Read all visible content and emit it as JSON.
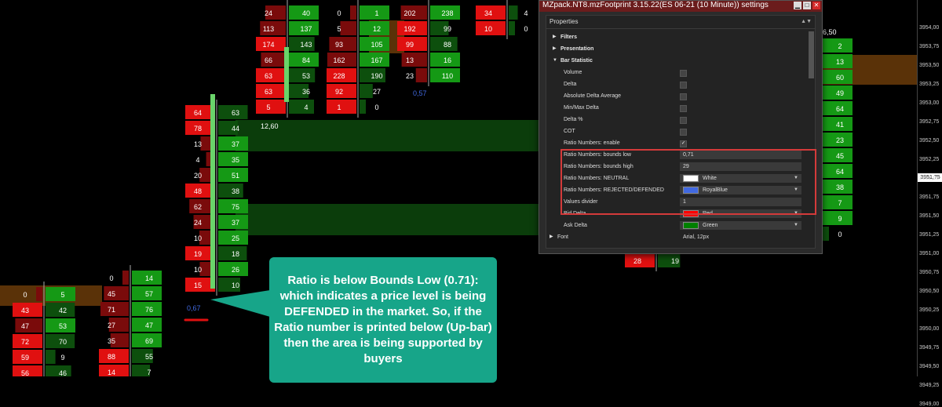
{
  "dialog": {
    "title": "MZpack.NT8.mzFootprint 3.15.22(ES 06-21 (10 Minute)) settings",
    "controls": {
      "minimize": "▁",
      "maximize": "□",
      "close": "✕"
    },
    "properties_header": "Properties",
    "categories": [
      {
        "label": "Filters",
        "expanded": false
      },
      {
        "label": "Presentation",
        "expanded": false
      },
      {
        "label": "Bar Statistic",
        "expanded": true
      }
    ],
    "items": [
      {
        "label": "Volume",
        "type": "checkbox",
        "checked": false
      },
      {
        "label": "Delta",
        "type": "checkbox",
        "checked": false
      },
      {
        "label": "Absolute Delta Average",
        "type": "checkbox",
        "checked": false
      },
      {
        "label": "Min/Max Delta",
        "type": "checkbox",
        "checked": false
      },
      {
        "label": "Delta %",
        "type": "checkbox",
        "checked": false
      },
      {
        "label": "COT",
        "type": "checkbox",
        "checked": false
      },
      {
        "label": "Ratio Numbers: enable",
        "type": "checkbox",
        "checked": true,
        "mark": "✓"
      },
      {
        "label": "Ratio Numbers: bounds low",
        "type": "text",
        "value": "0,71"
      },
      {
        "label": "Ratio Numbers: bounds high",
        "type": "text",
        "value": "29"
      },
      {
        "label": "Ratio Numbers: NEUTRAL",
        "type": "color",
        "value": "White",
        "color": "#ffffff"
      },
      {
        "label": "Ratio Numbers: REJECTED/DEFENDED",
        "type": "color",
        "value": "RoyalBlue",
        "color": "#4169e1"
      },
      {
        "label": "Values divider",
        "type": "text",
        "value": "1"
      },
      {
        "label": "Bid Delta",
        "type": "color",
        "value": "Red",
        "color": "#ff0000"
      },
      {
        "label": "Ask Delta",
        "type": "color",
        "value": "Green",
        "color": "#008000"
      }
    ],
    "font": {
      "label": "Font",
      "value": "Arial, 12px"
    }
  },
  "price_axis": {
    "ticks": [
      "3954,00",
      "3953,75",
      "3953,50",
      "3953,25",
      "3953,00",
      "3952,75",
      "3952,50",
      "3952,25",
      "3952,00",
      "3951,75",
      "3951,50",
      "3951,25",
      "3951,00",
      "3950,75",
      "3950,50",
      "3950,25",
      "3950,00",
      "3949,75",
      "3949,50",
      "3949,25",
      "3949,00"
    ],
    "current": "3951,75"
  },
  "colors": {
    "bid_strong": "#e01010",
    "bid_dark": "#7a0b0b",
    "ask_strong": "#159915",
    "ask_dark": "#0d4f0d",
    "zone_green": "#0b3d0b",
    "zone_orange": "#5a3208",
    "ratio_blue": "#4169e1"
  },
  "chart_labels": {
    "ratio_right": "6,50",
    "ratio_mid": "12,60",
    "ratio_top": "0,57",
    "ratio_left": "0,67"
  },
  "callout": {
    "text": "Ratio is below Bounds Low (0.71): which indicates a price level is being DEFENDED in the market. So, if the Ratio number is printed below (Up-bar) then the area is being supported by buyers"
  },
  "footprint": {
    "columns": [
      {
        "name": "left",
        "rows": [
          [
            "0",
            "5"
          ],
          [
            "43",
            "42"
          ],
          [
            "47",
            "53"
          ],
          [
            "72",
            "70"
          ],
          [
            "59",
            "9"
          ],
          [
            "56",
            "46"
          ]
        ]
      },
      {
        "name": "left2",
        "rows": [
          [
            "0",
            "14"
          ],
          [
            "45",
            "57"
          ],
          [
            "71",
            "76"
          ],
          [
            "27",
            "47"
          ],
          [
            "35",
            "69"
          ],
          [
            "88",
            "55"
          ],
          [
            "14",
            "7"
          ]
        ]
      },
      {
        "name": "main",
        "rows": [
          [
            "64",
            "63"
          ],
          [
            "78",
            "44"
          ],
          [
            "13",
            "37"
          ],
          [
            "4",
            "35"
          ],
          [
            "20",
            "51"
          ],
          [
            "48",
            "38"
          ],
          [
            "62",
            "75"
          ],
          [
            "24",
            "37"
          ],
          [
            "10",
            "25"
          ],
          [
            "19",
            "18"
          ],
          [
            "10",
            "26"
          ],
          [
            "15",
            "10"
          ]
        ],
        "top": [
          "45"
        ]
      },
      {
        "name": "upper",
        "rows": [
          [
            "24",
            "40"
          ],
          [
            "113",
            "137"
          ],
          [
            "174",
            "143"
          ],
          [
            "66",
            "84"
          ],
          [
            "63",
            "53"
          ],
          [
            "63",
            "36"
          ],
          [
            "5",
            "4"
          ]
        ]
      },
      {
        "name": "upper2",
        "rows": [
          [
            "0",
            "1"
          ],
          [
            "5",
            "12"
          ],
          [
            "93",
            "105"
          ],
          [
            "162",
            "167"
          ],
          [
            "228",
            "190"
          ],
          [
            "92",
            "27"
          ],
          [
            "1",
            "0"
          ]
        ]
      },
      {
        "name": "upper3",
        "rows": [
          [
            "202",
            "238"
          ],
          [
            "192",
            "99"
          ],
          [
            "99",
            "88"
          ],
          [
            "13",
            "16"
          ],
          [
            "23",
            "110"
          ]
        ]
      },
      {
        "name": "upper4",
        "rows": [
          [
            "34",
            "4"
          ],
          [
            "10",
            "0"
          ]
        ]
      },
      {
        "name": "right",
        "rows": [
          [
            "",
            "2"
          ],
          [
            "",
            "13"
          ],
          [
            "",
            "60"
          ],
          [
            "",
            "49"
          ],
          [
            "",
            "64"
          ],
          [
            "",
            "41"
          ],
          [
            "",
            "23"
          ],
          [
            "",
            "45"
          ],
          [
            "",
            "64"
          ],
          [
            "",
            "38"
          ],
          [
            "",
            "7"
          ],
          [
            "",
            "9"
          ],
          [
            "",
            "0"
          ]
        ]
      },
      {
        "name": "right-bottom",
        "rows": [
          [
            "28",
            "19"
          ]
        ]
      }
    ]
  }
}
